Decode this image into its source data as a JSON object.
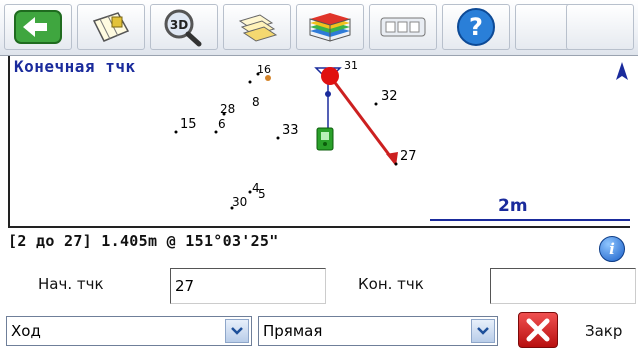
{
  "toolbar": {
    "buttons": [
      {
        "name": "back-button",
        "icon": "back-arrow-icon",
        "color": "#3fa63f"
      },
      {
        "name": "survey-points-button",
        "icon": "survey-grid-icon"
      },
      {
        "name": "zoom-3d-button",
        "icon": "magnifier-3d-icon",
        "text": "3D"
      },
      {
        "name": "layers-button",
        "icon": "layers-icon"
      },
      {
        "name": "map-layers-button",
        "icon": "colored-layers-icon"
      },
      {
        "name": "keypad-button",
        "icon": "keypad-icon",
        "text": "000"
      },
      {
        "name": "help-button",
        "icon": "question-icon",
        "text": "?"
      }
    ]
  },
  "map": {
    "title": "Конечная тчк",
    "north_icon": "north-arrow-icon",
    "scale_label": "2m",
    "points": [
      {
        "label": "16",
        "color": "#000000"
      },
      {
        "label": "8",
        "color": "#000000"
      },
      {
        "label": "32",
        "color": "#000000"
      },
      {
        "label": "28",
        "color": "#000000"
      },
      {
        "label": "15",
        "color": "#000000"
      },
      {
        "label": "6",
        "color": "#000000"
      },
      {
        "label": "33",
        "color": "#000000"
      },
      {
        "label": "27",
        "color": "#000000"
      },
      {
        "label": "4",
        "color": "#000000"
      },
      {
        "label": "5",
        "color": "#000000"
      },
      {
        "label": "30",
        "color": "#000000"
      },
      {
        "label": "31",
        "color": "#000000"
      }
    ],
    "line_color": "#cc2020",
    "current_point_color": "#e01010",
    "rover_color": "#2aa02a"
  },
  "info": {
    "text": "[2 до 27] 1.405m @ 151°03'25\"",
    "info_icon": "info-icon"
  },
  "form": {
    "start_label": "Нач. тчк",
    "start_value": "27",
    "end_label": "Кон. тчк",
    "end_value": ""
  },
  "bottom": {
    "mode_value": "Ход",
    "line_value": "Прямая",
    "close_label": "Закр",
    "close_icon": "close-x-icon",
    "dropdown_icon": "chevron-down-icon"
  }
}
